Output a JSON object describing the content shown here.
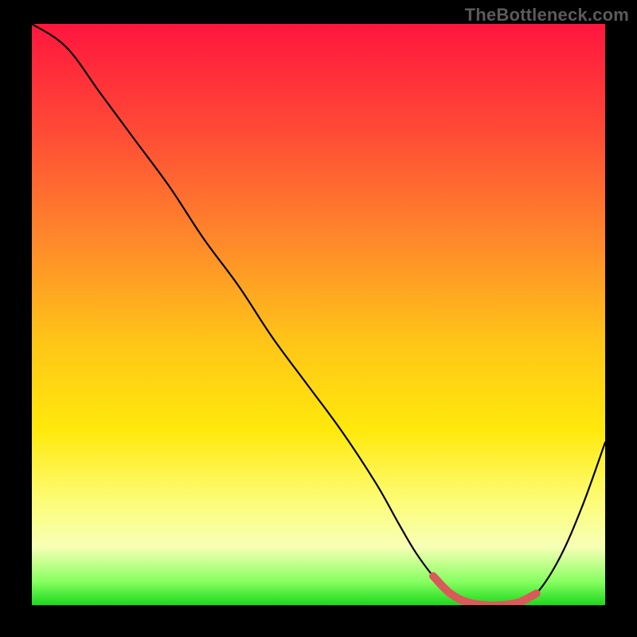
{
  "watermark": "TheBottleneck.com",
  "chart_data": {
    "type": "line",
    "title": "",
    "xlabel": "",
    "ylabel": "",
    "xlim": [
      0,
      100
    ],
    "ylim": [
      0,
      100
    ],
    "series": [
      {
        "name": "bottleneck-curve",
        "x": [
          0,
          6,
          12,
          18,
          24,
          30,
          36,
          42,
          48,
          54,
          60,
          64,
          67,
          70,
          73,
          76,
          79,
          82,
          85,
          88,
          92,
          96,
          100
        ],
        "values": [
          100,
          96,
          88,
          80,
          72,
          63,
          55,
          46,
          38,
          30,
          21,
          14,
          9,
          5,
          2,
          0.5,
          0,
          0,
          0.5,
          2,
          8,
          17,
          28
        ]
      }
    ],
    "highlight": {
      "name": "optimal-range",
      "x": [
        70,
        73,
        76,
        79,
        82,
        85,
        88
      ],
      "values": [
        5,
        2,
        0.5,
        0,
        0,
        0.5,
        2
      ]
    },
    "gradient_stops": [
      {
        "pos": 0,
        "color": "#ff163e"
      },
      {
        "pos": 18,
        "color": "#ff4936"
      },
      {
        "pos": 38,
        "color": "#ff8b2a"
      },
      {
        "pos": 55,
        "color": "#ffc617"
      },
      {
        "pos": 70,
        "color": "#ffe90c"
      },
      {
        "pos": 82,
        "color": "#fdfc76"
      },
      {
        "pos": 90,
        "color": "#f7ffb5"
      },
      {
        "pos": 96,
        "color": "#86ff60"
      },
      {
        "pos": 100,
        "color": "#1cd81c"
      }
    ]
  }
}
